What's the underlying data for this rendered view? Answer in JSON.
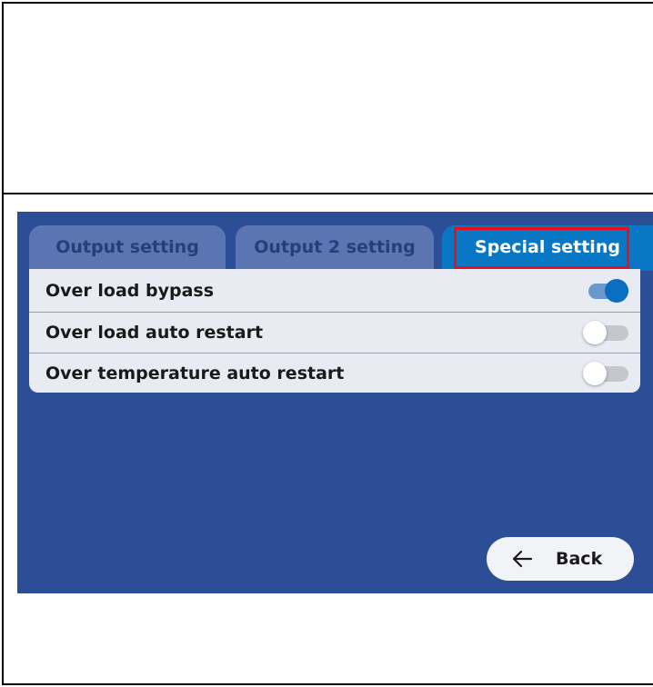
{
  "tabs": [
    {
      "label": "Output setting",
      "active": false
    },
    {
      "label": "Output 2 setting",
      "active": false
    },
    {
      "label": "Special setting",
      "active": true
    }
  ],
  "settings": [
    {
      "label": "Over load bypass",
      "enabled": true
    },
    {
      "label": "Over load auto restart",
      "enabled": false
    },
    {
      "label": "Over temperature auto restart",
      "enabled": false
    }
  ],
  "back_button": {
    "label": "Back",
    "icon": "arrow-left-icon"
  },
  "colors": {
    "screen_bg": "#2c4e96",
    "active_tab": "#0a77c4",
    "inactive_tab": "#5b74b2",
    "highlight": "#e8111b",
    "toggle_on": "#0a6fc0"
  }
}
